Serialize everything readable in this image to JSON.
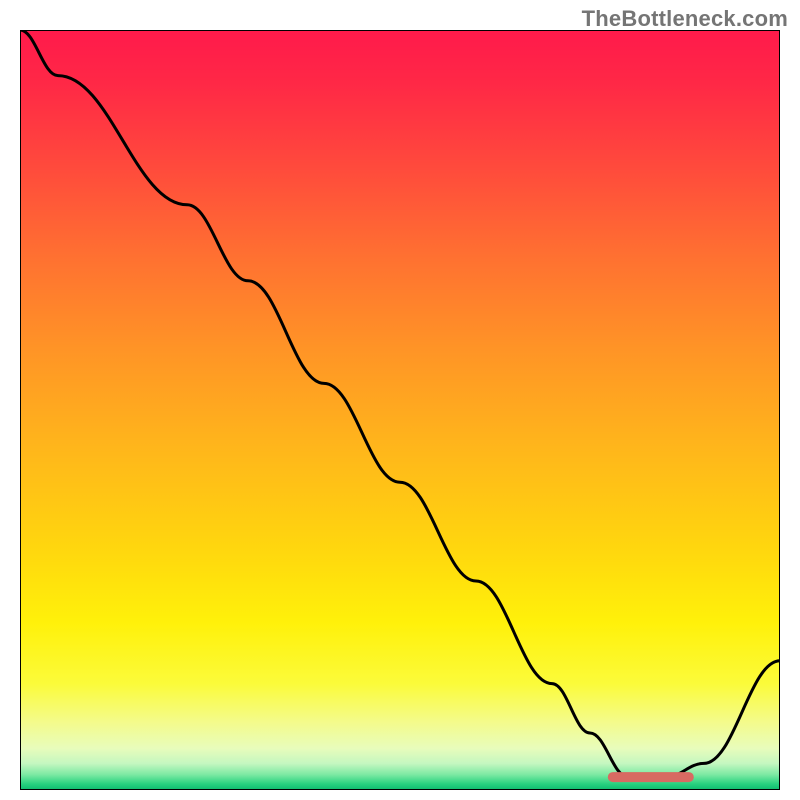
{
  "watermark": "TheBottleneck.com",
  "chart_data": {
    "type": "line",
    "title": "",
    "xlabel": "",
    "ylabel": "",
    "xlim": [
      0,
      100
    ],
    "ylim": [
      0,
      100
    ],
    "x": [
      0,
      5,
      22,
      30,
      40,
      50,
      60,
      70,
      75,
      80,
      85,
      90,
      100
    ],
    "y": [
      100,
      94,
      77,
      67,
      53.5,
      40.5,
      27.5,
      14,
      7.5,
      1.7,
      1.7,
      3.5,
      17
    ],
    "marker_segment": {
      "x_start": 78,
      "x_end": 88,
      "y": 1.7
    },
    "gradient_stops": [
      {
        "offset": 0.0,
        "color": "#ff1a4b"
      },
      {
        "offset": 0.07,
        "color": "#ff2846"
      },
      {
        "offset": 0.18,
        "color": "#ff4a3c"
      },
      {
        "offset": 0.3,
        "color": "#ff7131"
      },
      {
        "offset": 0.42,
        "color": "#ff9426"
      },
      {
        "offset": 0.55,
        "color": "#ffb61b"
      },
      {
        "offset": 0.68,
        "color": "#ffd60e"
      },
      {
        "offset": 0.78,
        "color": "#fff10a"
      },
      {
        "offset": 0.86,
        "color": "#fbfb3a"
      },
      {
        "offset": 0.91,
        "color": "#f4fb8a"
      },
      {
        "offset": 0.945,
        "color": "#e8fcbb"
      },
      {
        "offset": 0.965,
        "color": "#c5f7c0"
      },
      {
        "offset": 0.98,
        "color": "#7be9a2"
      },
      {
        "offset": 0.992,
        "color": "#28d17f"
      },
      {
        "offset": 1.0,
        "color": "#0dbb6e"
      }
    ],
    "marker_color": "#d86a62",
    "line_color": "#000000",
    "border_color": "#000000",
    "line_width": 3,
    "marker_width": 10
  }
}
